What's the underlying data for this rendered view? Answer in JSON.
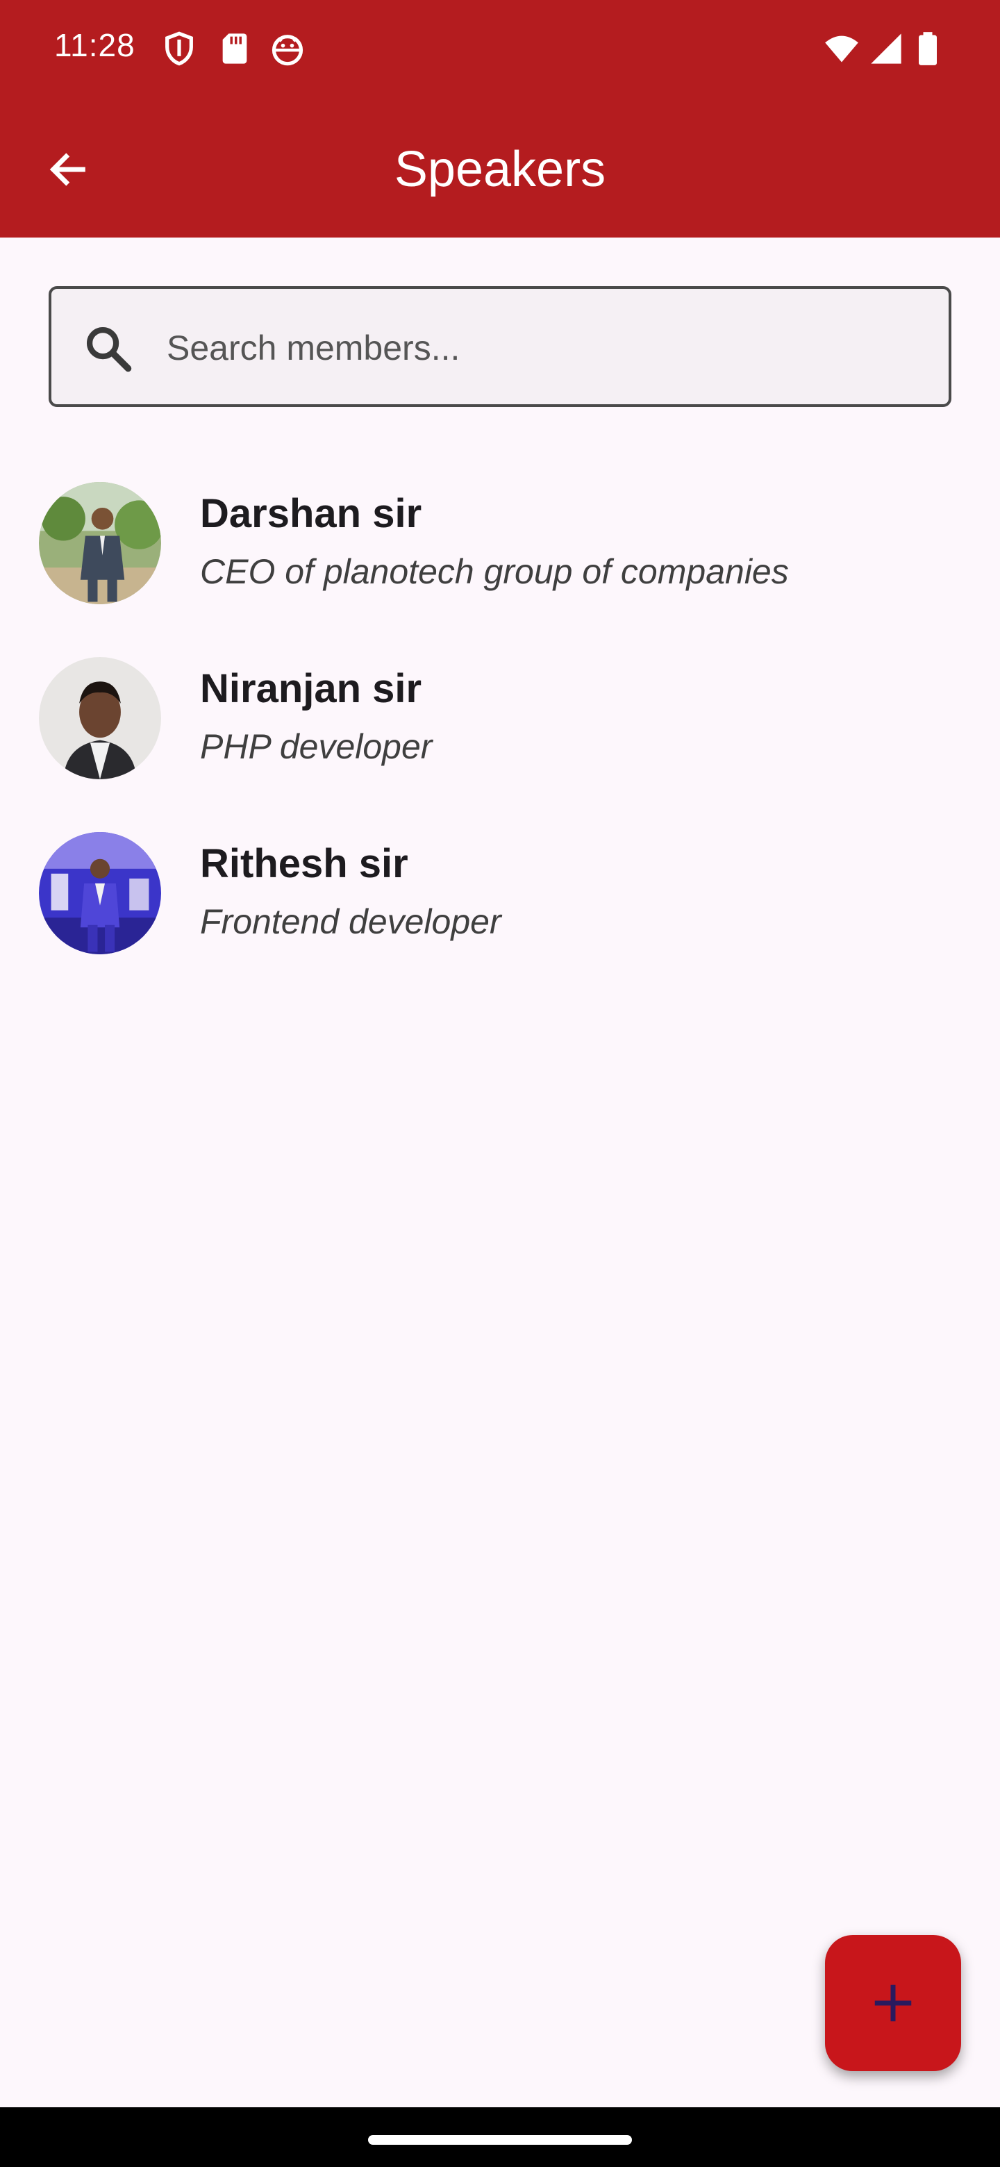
{
  "status_bar": {
    "time": "11:28",
    "left_icons": [
      "shield-icon",
      "sd-card-icon",
      "android-face-icon"
    ],
    "right_icons": [
      "wifi-icon",
      "signal-icon",
      "battery-icon"
    ]
  },
  "app_bar": {
    "title": "Speakers",
    "back_icon": "arrow-back-icon",
    "color": "#b41c1f"
  },
  "search": {
    "placeholder": "Search members...",
    "value": "",
    "icon": "search-icon"
  },
  "members": [
    {
      "name": "Darshan sir",
      "role": "CEO of planotech group of companies"
    },
    {
      "name": "Niranjan sir",
      "role": "PHP developer"
    },
    {
      "name": "Rithesh sir",
      "role": "Frontend developer"
    }
  ],
  "fab": {
    "icon": "plus-icon",
    "color": "#c8161b",
    "icon_color": "#2a1a5e"
  }
}
